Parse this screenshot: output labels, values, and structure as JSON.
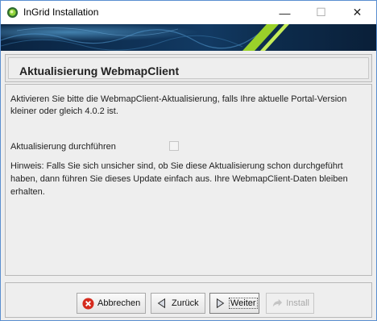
{
  "window": {
    "title": "InGrid Installation",
    "controls": {
      "minimize": "—",
      "maximize": "☐",
      "close": "✕"
    }
  },
  "page": {
    "title": "Aktualisierung WebmapClient",
    "intro": "Aktivieren Sie bitte die WebmapClient-Aktualisierung, falls Ihre aktuelle Portal-Version kleiner oder gleich 4.0.2 ist.",
    "checkbox_label": "Aktualisierung durchführen",
    "checkbox_checked": false,
    "hint": "Hinweis: Falls Sie sich unsicher sind, ob Sie diese Aktualisierung schon durchgeführt haben, dann führen Sie dieses Update einfach aus. Ihre WebmapClient-Daten bleiben erhalten."
  },
  "buttons": {
    "cancel": "Abbrechen",
    "back": "Zurück",
    "next": "Weiter",
    "install": "Install"
  },
  "icons": {
    "app": "ingrid-logo-icon",
    "cancel": "cancel-x-icon",
    "back": "arrow-left-icon",
    "next": "arrow-right-icon",
    "install": "install-arrow-icon"
  },
  "colors": {
    "banner_dark": "#0b2a4a",
    "banner_green": "#9ad12a",
    "cancel_red": "#d52b1e"
  }
}
